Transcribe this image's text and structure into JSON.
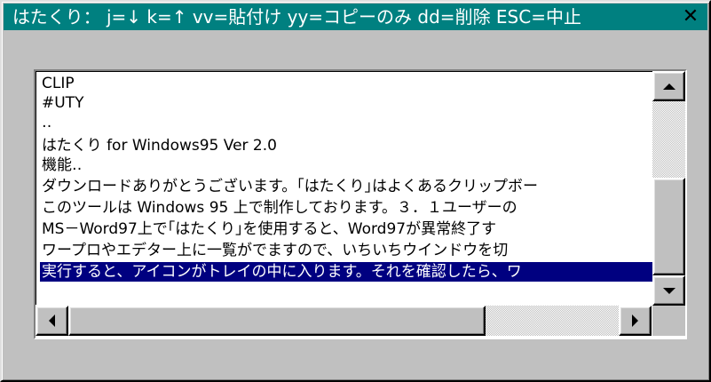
{
  "window": {
    "title": "はたくり： j=↓  k=↑  vv=貼付け  yy=コピーのみ  dd=削除  ESC=中止",
    "close_glyph": "✕"
  },
  "list": {
    "lines": [
      "CLIP",
      "#UTY",
      "‥",
      "はたくり for Windows95 Ver 2.0",
      "機能‥",
      "  ダウンロードありがとうございます。｢はたくり｣はよくあるクリップボー",
      "  このツールは Windows 95 上で制作しております。３．１ユーザーの",
      "  MS－Word97上で｢はたくり｣を使用すると、Word97が異常終了す",
      "  ワープロやエデター上に一覧がでますので、いちいちウインドウを切",
      "  実行すると、アイコンがトレイの中に入ります。それを確認したら、ワ"
    ],
    "selected_index": 9
  },
  "scrollbars": {
    "vertical": {
      "up_icon": "arrow-up",
      "down_icon": "arrow-down",
      "position_fraction": 1.0
    },
    "horizontal": {
      "left_icon": "arrow-left",
      "right_icon": "arrow-right",
      "position_fraction": 0.0
    }
  },
  "colors": {
    "titlebar": "#008080",
    "selection": "#000080",
    "face": "#c0c0c0"
  }
}
